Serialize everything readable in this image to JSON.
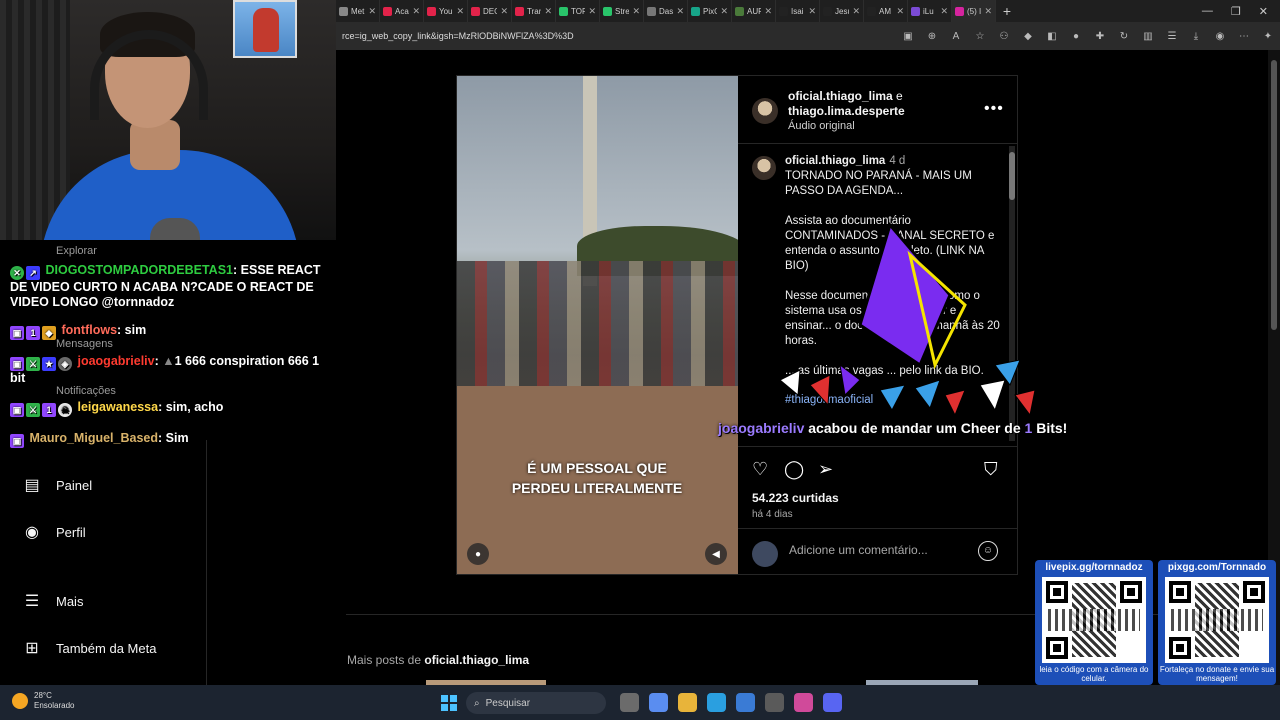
{
  "browser": {
    "tabs": [
      {
        "label": "Met",
        "color": "#888888"
      },
      {
        "label": "Aca",
        "color": "#e2234a"
      },
      {
        "label": "You",
        "color": "#e2234a"
      },
      {
        "label": "DEC",
        "color": "#e2234a"
      },
      {
        "label": "Tran",
        "color": "#e2234a"
      },
      {
        "label": "TOR",
        "color": "#29c46a"
      },
      {
        "label": "Stre",
        "color": "#29c46a"
      },
      {
        "label": "Dash",
        "color": "#777777"
      },
      {
        "label": "PixG",
        "color": "#17a589"
      },
      {
        "label": "AUF",
        "color": "#4a7a3a"
      },
      {
        "label": "Isai",
        "color": "#222222"
      },
      {
        "label": "Jesu",
        "color": "#222222"
      },
      {
        "label": "AM",
        "color": "#222222"
      },
      {
        "label": "iLu",
        "color": "#7b4bd6"
      },
      {
        "label": "(5) I",
        "color": "#d6249f"
      }
    ],
    "url": "rce=ig_web_copy_link&igsh=MzRlODBiNWFlZA%3D%3D"
  },
  "post": {
    "owner": "oficial.thiago_lima",
    "connector": "e",
    "collaborator": "thiago.lima.desperte",
    "audio": "Áudio original",
    "video_caption_line1": "É UM PESSOAL QUE",
    "video_caption_line2": "PERDEU LITERALMENTE",
    "comment_user": "oficial.thiago_lima",
    "comment_time": "4 d",
    "caption_p1": "TORNADO NO PARANÁ - MAIS UM PASSO DA AGENDA...",
    "caption_p2": "Assista ao documentário CONTAMINADOS - CANAL SECRETO e entenda o assunto completo. (LINK NA BIO)",
    "caption_p3": "Nesse documentário mostrará como o sistema usa os ventos controlar e ensinar... o documentário... amanhã às 20 horas.",
    "caption_p4": "... as últimas vagas ... pelo link da BIO.",
    "hashtag": "#thiagolimaoficial",
    "likes": "54.223 curtidas",
    "ago": "há 4 dias",
    "comment_placeholder": "Adicione um comentário..."
  },
  "more_posts": {
    "prefix": "Mais posts de",
    "user": "oficial.thiago_lima"
  },
  "ig_nav": {
    "explorar": "Explorar",
    "mensagens": "Mensagens",
    "notificacoes": "Notificações",
    "painel": "Painel",
    "perfil": "Perfil",
    "mais": "Mais",
    "meta": "Também da Meta"
  },
  "chat": [
    {
      "user": "DIOGOSTOMPADORDEBETAS1",
      "color": "#2ecc40",
      "msg": "ESSE REACT DE VIDEO CURTO N ACABA N?CADE O REACT DE VIDEO LONGO @tornnadoz"
    },
    {
      "user": "fontflows",
      "color": "#ff6b5a",
      "msg": "sim"
    },
    {
      "user": "joaogabrieliv",
      "color": "#ff3b30",
      "msg": "1 666 conspiration 666 1 bit"
    },
    {
      "user": "leigawanessa",
      "color": "#ffd84a",
      "msg": "sim, acho"
    },
    {
      "user": "Mauro_Miguel_Based",
      "color": "#d9b36a",
      "msg": "Sim"
    }
  ],
  "cheer": {
    "user": "joaogabrieliv",
    "text": "acabou de mandar um Cheer de",
    "amount": "1",
    "unit": "Bits!"
  },
  "qr": [
    {
      "title": "livepix.gg/tornnadoz",
      "foot": "leia o código com a câmera do celular."
    },
    {
      "title": "pixgg.com/Tornnado",
      "foot": "Fortaleça no donate e envie sua mensagem!"
    }
  ],
  "taskbar": {
    "temp": "28°C",
    "weather": "Ensolarado",
    "search_placeholder": "Pesquisar"
  }
}
